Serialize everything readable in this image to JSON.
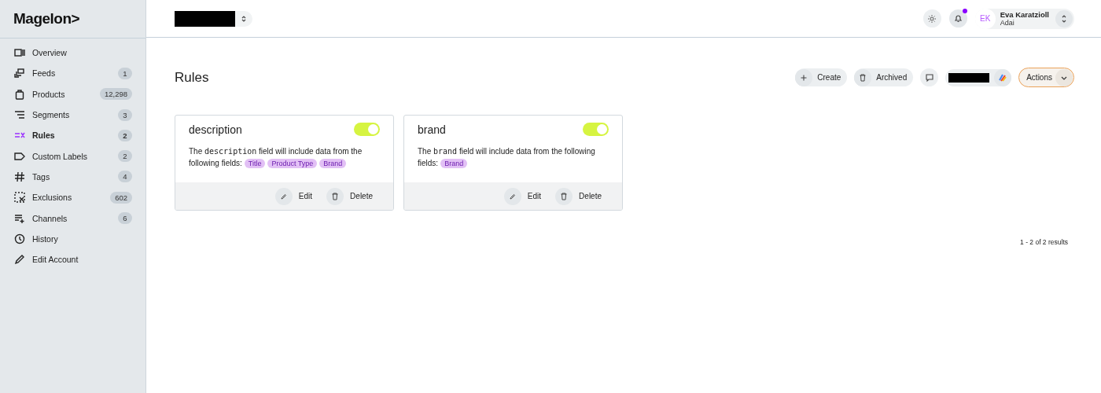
{
  "logo": "Magelon>",
  "sidebar": {
    "items": [
      {
        "label": "Overview",
        "selected": false
      },
      {
        "label": "Feeds",
        "count": "1",
        "selected": false
      },
      {
        "label": "Products",
        "count": "12,298",
        "selected": false
      },
      {
        "label": "Segments",
        "count": "3",
        "selected": false
      },
      {
        "label": "Rules",
        "count": "2",
        "selected": true
      },
      {
        "label": "Custom Labels",
        "count": "2",
        "selected": false
      },
      {
        "label": "Tags",
        "count": "4",
        "selected": false
      },
      {
        "label": "Exclusions",
        "count": "602",
        "selected": false
      },
      {
        "label": "Channels",
        "count": "6",
        "selected": false
      },
      {
        "label": "History",
        "selected": false
      },
      {
        "label": "Edit Account",
        "selected": false
      }
    ]
  },
  "header": {
    "user": {
      "initials": "EK",
      "name": "Eva Karatzioll",
      "org": "Adai"
    },
    "notifications_unread": true
  },
  "page": {
    "title": "Rules",
    "toolbar": {
      "create": "Create",
      "archived": "Archived",
      "actions": "Actions"
    }
  },
  "rules": [
    {
      "title": "description",
      "on": true,
      "text_before": "The",
      "field": "description",
      "text_after": "field will include data from the following fields:",
      "tags": [
        "Title",
        "Product Type",
        "Brand"
      ],
      "edit": "Edit",
      "delete": "Delete"
    },
    {
      "title": "brand",
      "on": true,
      "text_before": "The",
      "field": "brand",
      "text_after": "field will include data from the following fields:",
      "tags": [
        "Brand"
      ],
      "edit": "Edit",
      "delete": "Delete"
    }
  ],
  "pagination": "1 - 2 of 2 results"
}
